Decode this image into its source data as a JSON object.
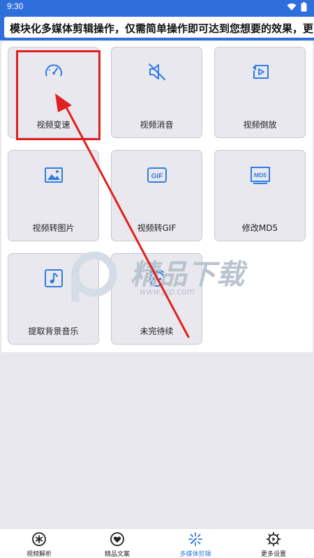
{
  "colors": {
    "accent": "#2f7de1",
    "header_blue": "#2f6fdc",
    "tile_bg": "#e9e8ee",
    "annotation_red": "#e02020"
  },
  "status_bar": {
    "time": "9:30",
    "icons": [
      "wifi-icon",
      "battery-icon"
    ]
  },
  "banner": {
    "text": "模块化多媒体剪辑操作，仅需简单操作即可达到您想要的效果，更"
  },
  "tiles": [
    {
      "label": "视频变速",
      "icon": "speedometer-icon"
    },
    {
      "label": "视频消音",
      "icon": "mute-icon"
    },
    {
      "label": "视频倒放",
      "icon": "reverse-play-icon"
    },
    {
      "label": "视频转图片",
      "icon": "image-icon"
    },
    {
      "label": "视频转GIF",
      "icon": "gif-icon",
      "icon_text": "GIF"
    },
    {
      "label": "修改MD5",
      "icon": "md5-icon",
      "icon_text": "MD5"
    },
    {
      "label": "提取背景音乐",
      "icon": "music-note-icon"
    },
    {
      "label": "未完待续",
      "icon": "more-icon"
    }
  ],
  "watermark": {
    "text": "精品下载",
    "sub": "www.jsp.com"
  },
  "bottom_nav": [
    {
      "label": "视频解析",
      "icon": "asterisk-circle-icon",
      "active": false
    },
    {
      "label": "精品文案",
      "icon": "heart-circle-icon",
      "active": false
    },
    {
      "label": "多媒体剪辑",
      "icon": "sparkle-icon",
      "active": true
    },
    {
      "label": "更多设置",
      "icon": "settings-gear-icon",
      "active": false
    }
  ]
}
